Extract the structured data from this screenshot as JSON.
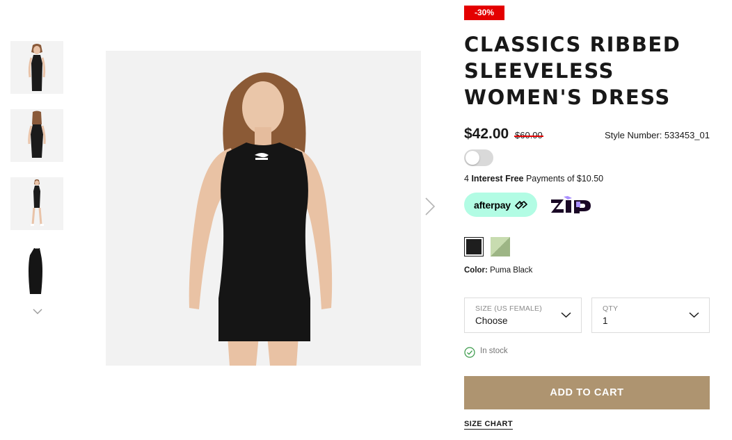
{
  "product": {
    "discount_badge": "-30%",
    "title": "CLASSICS RIBBED SLEEVELESS WOMEN'S DRESS",
    "price": "$42.00",
    "original_price": "$60.00",
    "style_number": "Style Number: 533453_01"
  },
  "payments": {
    "interest_prefix": "4 ",
    "interest_bold": "Interest Free",
    "interest_suffix": " Payments of $10.50",
    "afterpay_label": "afterpay",
    "zip_label": "zip"
  },
  "colors": {
    "label": "Color:",
    "selected": "Puma Black",
    "swatches": [
      "#1e1e1e",
      "#c8dcb0"
    ]
  },
  "selectors": {
    "size_label": "SIZE (US FEMALE)",
    "size_value": "Choose",
    "qty_label": "QTY",
    "qty_value": "1"
  },
  "stock": "In stock",
  "actions": {
    "add_to_cart": "ADD TO CART",
    "size_chart": "SIZE CHART"
  },
  "theme": {
    "accent": "#ae9470",
    "sale_red": "#e40000",
    "afterpay_mint": "#b2fce4",
    "zip_purple": "#aa8fff"
  },
  "gallery": {
    "thumbnails": [
      "dress-front",
      "dress-back",
      "dress-full-body",
      "dress-flat"
    ],
    "active_thumbnail": 1
  }
}
